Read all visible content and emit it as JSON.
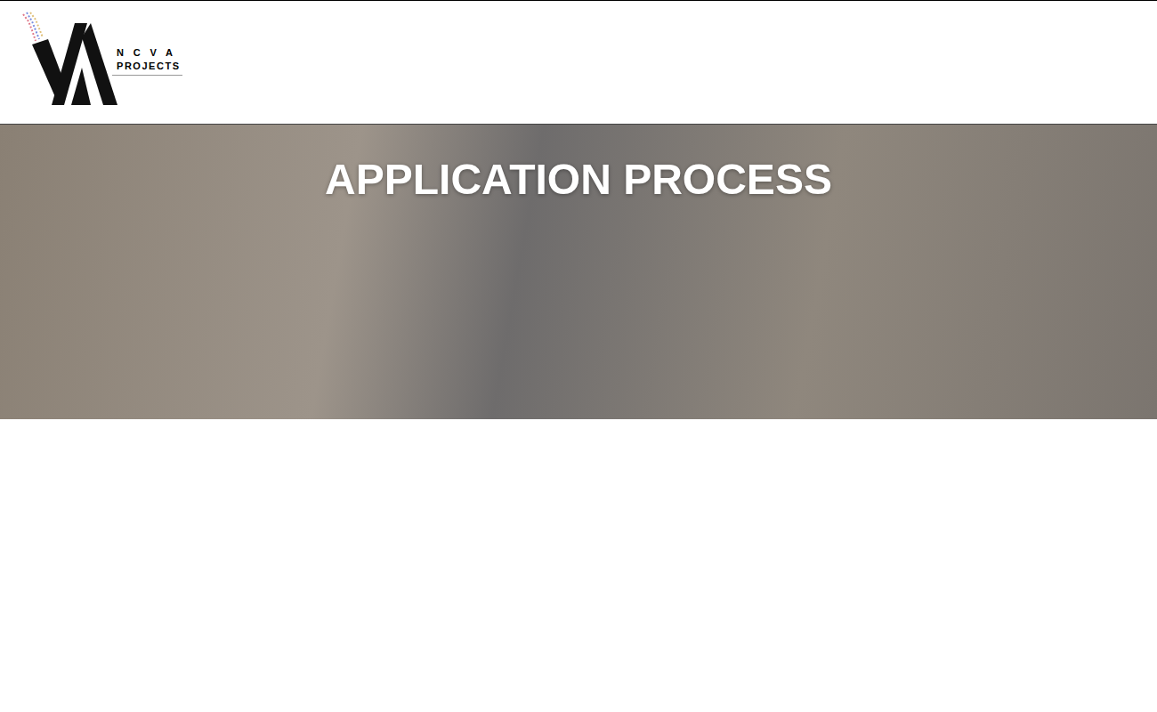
{
  "header": {
    "logo": {
      "top": "N C V A",
      "bottom": "PROJECTS"
    }
  },
  "hero": {
    "title": "APPLICATION PROCESS"
  }
}
